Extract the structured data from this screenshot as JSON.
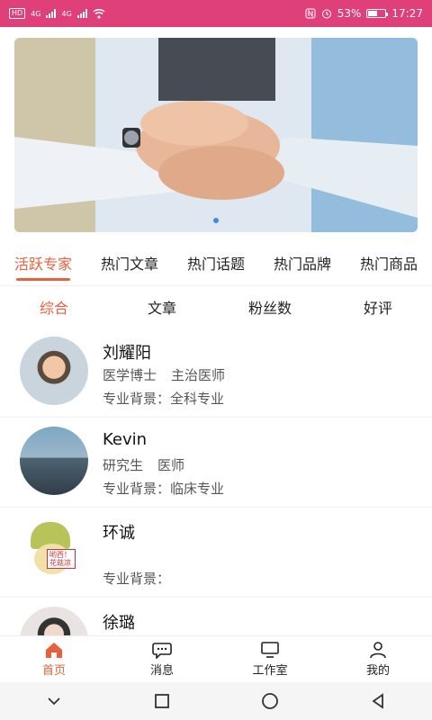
{
  "status_bar": {
    "left_badge": "HD",
    "signal_1": "4G",
    "signal_2": "4G",
    "battery": "53%",
    "time": "17:27"
  },
  "banner": {
    "slide_count": 2,
    "active_slide": 1
  },
  "category_tabs": [
    {
      "label": "活跃专家",
      "active": true
    },
    {
      "label": "热门文章",
      "active": false
    },
    {
      "label": "热门话题",
      "active": false
    },
    {
      "label": "热门品牌",
      "active": false
    },
    {
      "label": "热门商品",
      "active": false
    }
  ],
  "sort_tabs": [
    {
      "label": "综合",
      "active": true
    },
    {
      "label": "文章",
      "active": false
    },
    {
      "label": "粉丝数",
      "active": false
    },
    {
      "label": "好评",
      "active": false
    }
  ],
  "experts": [
    {
      "name": "刘耀阳",
      "degree": "医学博士",
      "title": "主治医师",
      "background": "专业背景：全科专业"
    },
    {
      "name": "Kevin",
      "degree": "研究生",
      "title": "医师",
      "background": "专业背景：临床专业"
    },
    {
      "name": "环诚",
      "degree": "",
      "title": "",
      "background": "专业背景：",
      "avatar_text": "哟西！花菇凉"
    },
    {
      "name": "徐璐",
      "degree": "",
      "title": "",
      "background": ""
    }
  ],
  "bottom_tabs": [
    {
      "label": "首页",
      "icon": "home-icon",
      "active": true
    },
    {
      "label": "消息",
      "icon": "chat-icon",
      "active": false
    },
    {
      "label": "工作室",
      "icon": "monitor-icon",
      "active": false
    },
    {
      "label": "我的",
      "icon": "person-icon",
      "active": false
    }
  ],
  "colors": {
    "status_bar": "#e0407a",
    "accent": "#e8603c"
  }
}
